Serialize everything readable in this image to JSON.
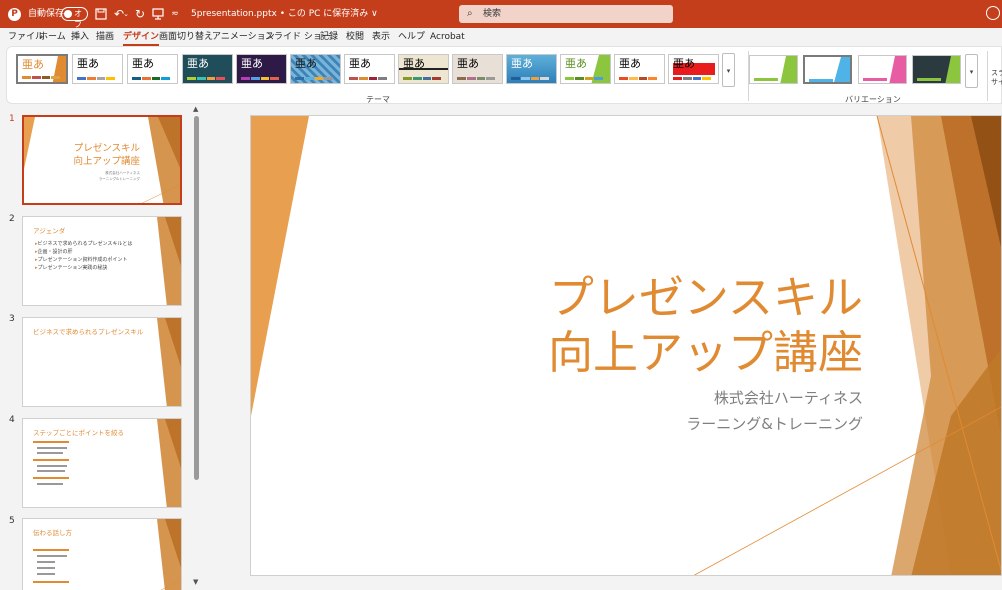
{
  "titlebar": {
    "autosave_label": "自動保存",
    "toggle_label": "オフ",
    "filename": "5presentation.pptx • この PC に保存済み ∨",
    "search_placeholder": "検索"
  },
  "menu": {
    "items": [
      "ファイル",
      "ホーム",
      "挿入",
      "描画",
      "デザイン",
      "画面切り替え",
      "アニメーション",
      "スライド ショー",
      "記録",
      "校閲",
      "表示",
      "ヘルプ",
      "Acrobat"
    ],
    "active": "デザイン"
  },
  "ribbon": {
    "theme_sample": "亜あ",
    "themes_group_label": "テーマ",
    "variations_group_label": "バリエーション",
    "right_label": "スラ サイ",
    "more_glyph": "▾"
  },
  "thumbnails": [
    {
      "number": "1",
      "title_line1": "プレゼンスキル",
      "title_line2": "向上アップ講座",
      "sub1": "株式会社ハーティネス",
      "sub2": "ラーニング&トレーニング"
    },
    {
      "number": "2",
      "title": "アジェンダ",
      "bullets": [
        "ビジネスで求められるプレゼンスキルとは",
        "企画・設計の肝",
        "プレゼンテーション資料作成のポイント",
        "プレゼンテーション実践の秘訣"
      ]
    },
    {
      "number": "3",
      "title": "ビジネスで求められるプレゼンスキル"
    },
    {
      "number": "4",
      "title": "ステップごとにポイントを絞る"
    },
    {
      "number": "5",
      "title": "伝わる話し方"
    }
  ],
  "slide": {
    "title_line1": "プレゼンスキル",
    "title_line2": "向上アップ講座",
    "subtitle1": "株式会社ハーティネス",
    "subtitle2": "ラーニング&トレーニング"
  },
  "colors": {
    "brand": "#c43e1c",
    "accent": "#e08a32"
  }
}
